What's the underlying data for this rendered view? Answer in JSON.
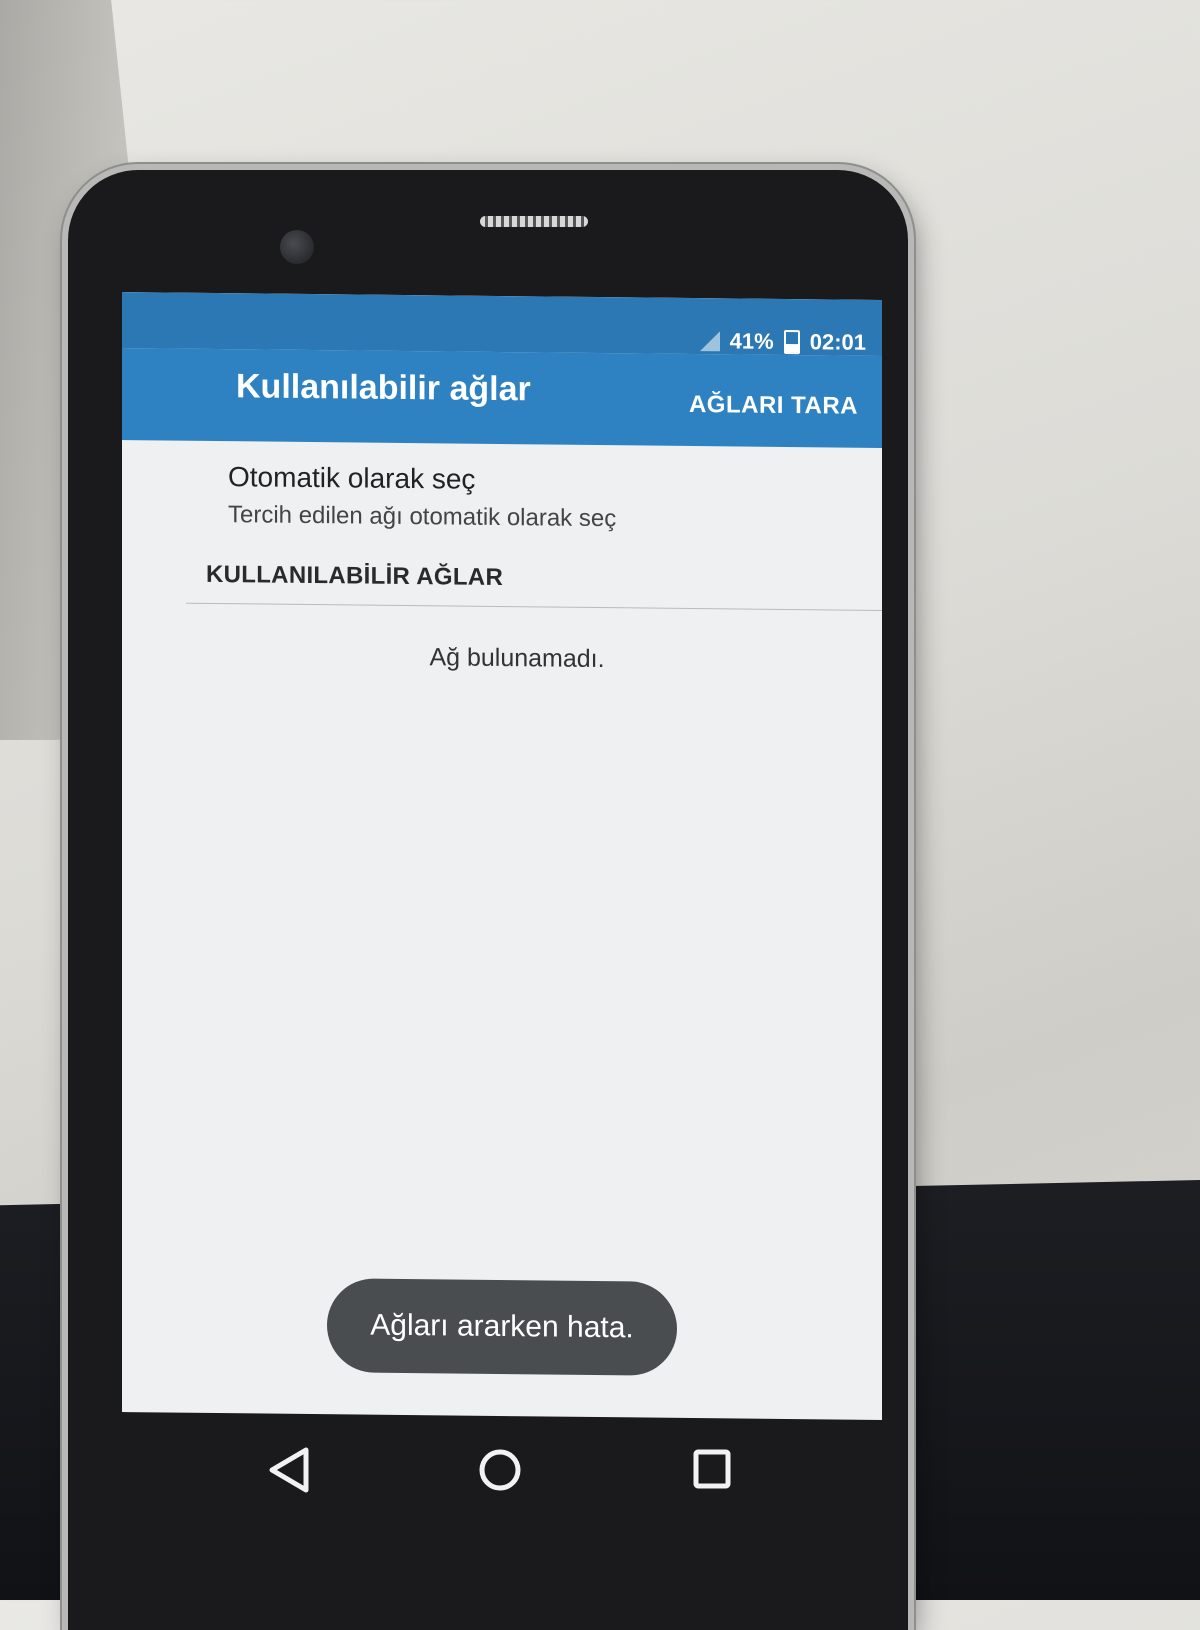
{
  "status_bar": {
    "battery": "41%",
    "time": "02:01",
    "icons": [
      "signal-icon",
      "battery-icon"
    ]
  },
  "app_bar": {
    "title": "Kullanılabilir ağlar",
    "action_label": "AĞLARI TARA"
  },
  "auto_select": {
    "title": "Otomatik olarak seç",
    "summary": "Tercih edilen ağı otomatik olarak seç"
  },
  "networks_section": {
    "header": "KULLANILABİLİR AĞLAR",
    "empty_message": "Ağ bulunamadı."
  },
  "toast": {
    "message": "Ağları ararken hata."
  },
  "navigation_bar": {
    "buttons": [
      "back-icon",
      "home-icon",
      "recents-icon"
    ]
  },
  "colors": {
    "status_bar": "#2c78b4",
    "app_bar": "#2f82c2",
    "screen_bg": "#eef0f1",
    "toast_bg": "#4a4d50"
  }
}
